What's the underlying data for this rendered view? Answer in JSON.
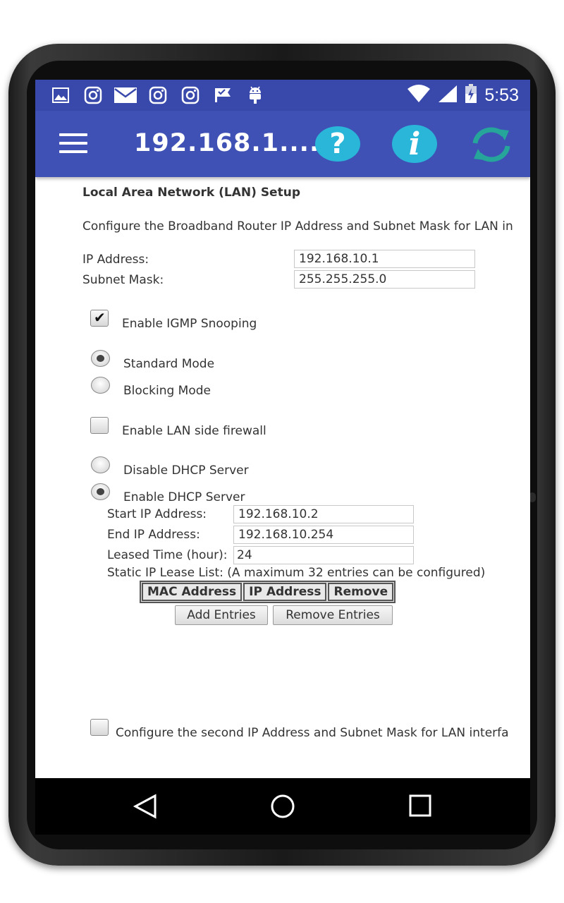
{
  "status_bar": {
    "time": "5:53",
    "notification_icons": [
      "image-icon",
      "instagram-icon",
      "mail-icon",
      "instagram-icon",
      "instagram-icon",
      "check-flag-icon",
      "android-icon"
    ],
    "system_icons": [
      "wifi-icon",
      "signal-icon",
      "battery-charging-icon"
    ]
  },
  "app_bar": {
    "title": "192.168.1....",
    "colors": {
      "status": "#3949ab",
      "bar": "#3f51b5",
      "help": "#29b6d9",
      "refresh": "#26a69a"
    }
  },
  "lan": {
    "heading": "Local Area Network (LAN) Setup",
    "description": "Configure the Broadband Router IP Address and Subnet Mask for LAN in",
    "ip_label": "IP Address:",
    "ip_value": "192.168.10.1",
    "mask_label": "Subnet Mask:",
    "mask_value": "255.255.255.0",
    "igmp_label": "Enable IGMP Snooping",
    "standard_mode": "Standard Mode",
    "blocking_mode": "Blocking Mode",
    "firewall_label": "Enable LAN side firewall",
    "disable_dhcp": "Disable DHCP Server",
    "enable_dhcp": "Enable DHCP Server"
  },
  "dhcp": {
    "start_label": "Start IP Address:",
    "start_value": "192.168.10.2",
    "end_label": "End IP Address:",
    "end_value": "192.168.10.254",
    "lease_label": "Leased Time (hour):",
    "lease_value": "24",
    "static_label": "Static IP Lease List: (A maximum 32 entries can be configured)",
    "columns": [
      "MAC Address",
      "IP Address",
      "Remove"
    ],
    "add_button": "Add Entries",
    "remove_button": "Remove Entries"
  },
  "second_ip": {
    "label": "Configure the second IP Address and Subnet Mask for LAN interfa"
  },
  "state": {
    "igmp_checked": true,
    "standard_mode_selected": true,
    "firewall_checked": false,
    "dhcp_enabled": true,
    "second_ip_checked": false
  }
}
